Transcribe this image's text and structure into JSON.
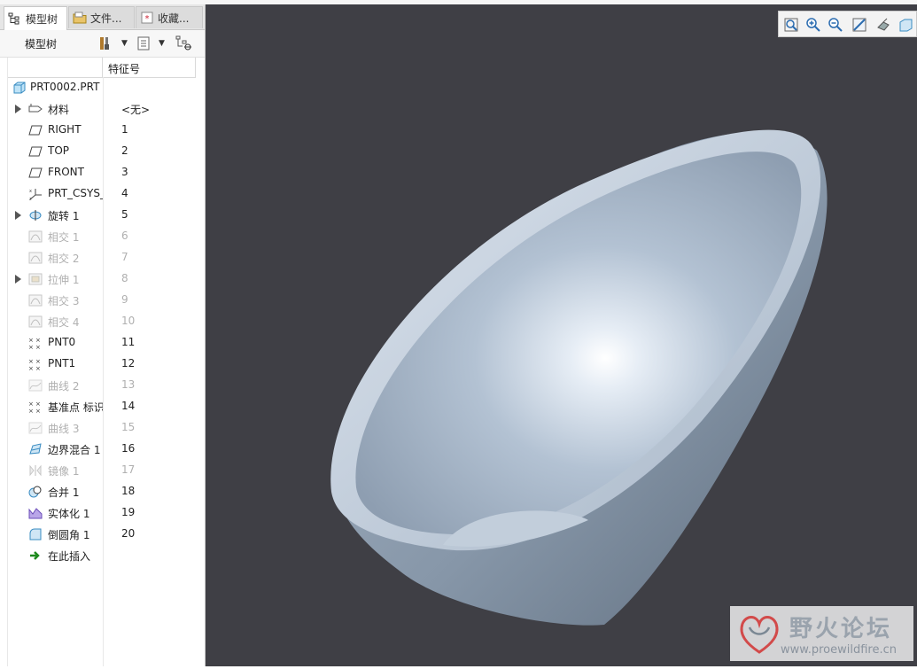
{
  "tabs": [
    {
      "label": "模型树",
      "icon": "model-tree-icon",
      "active": true
    },
    {
      "label": "文件...",
      "icon": "folder-icon"
    },
    {
      "label": "收藏...",
      "icon": "favorites-icon"
    }
  ],
  "toolbar": {
    "title": "模型树",
    "settings_icon": "settings-icon",
    "show_icon": "show-options-icon",
    "filter_icon": "filter-icon"
  },
  "columns": {
    "feature_id": "特征号"
  },
  "root": {
    "name": "PRT0002.PRT",
    "icon": "part-icon"
  },
  "features": [
    {
      "name": "材料",
      "num": "<无>",
      "icon": "material-icon",
      "expandable": true,
      "disabled": false
    },
    {
      "name": "RIGHT",
      "num": "1",
      "icon": "datum-plane-icon",
      "expandable": false,
      "disabled": false
    },
    {
      "name": "TOP",
      "num": "2",
      "icon": "datum-plane-icon",
      "expandable": false,
      "disabled": false
    },
    {
      "name": "FRONT",
      "num": "3",
      "icon": "datum-plane-icon",
      "expandable": false,
      "disabled": false
    },
    {
      "name": "PRT_CSYS_DEF",
      "num": "4",
      "icon": "csys-icon",
      "expandable": false,
      "disabled": false
    },
    {
      "name": "旋转 1",
      "num": "5",
      "icon": "revolve-icon",
      "expandable": true,
      "disabled": false
    },
    {
      "name": "相交 1",
      "num": "6",
      "icon": "intersect-icon",
      "expandable": false,
      "disabled": true
    },
    {
      "name": "相交 2",
      "num": "7",
      "icon": "intersect-icon",
      "expandable": false,
      "disabled": true
    },
    {
      "name": "拉伸 1",
      "num": "8",
      "icon": "extrude-icon",
      "expandable": true,
      "disabled": true
    },
    {
      "name": "相交 3",
      "num": "9",
      "icon": "intersect-icon",
      "expandable": false,
      "disabled": true
    },
    {
      "name": "相交 4",
      "num": "10",
      "icon": "intersect-icon",
      "expandable": false,
      "disabled": true
    },
    {
      "name": "PNT0",
      "num": "11",
      "icon": "datum-point-icon",
      "expandable": false,
      "disabled": false
    },
    {
      "name": "PNT1",
      "num": "12",
      "icon": "datum-point-icon",
      "expandable": false,
      "disabled": false
    },
    {
      "name": "曲线 2",
      "num": "13",
      "icon": "curve-icon",
      "expandable": false,
      "disabled": true
    },
    {
      "name": "基准点 标识",
      "num": "14",
      "icon": "datum-point-icon",
      "expandable": false,
      "disabled": false
    },
    {
      "name": "曲线 3",
      "num": "15",
      "icon": "curve-icon",
      "expandable": false,
      "disabled": true
    },
    {
      "name": "边界混合 1",
      "num": "16",
      "icon": "boundary-blend-icon",
      "expandable": false,
      "disabled": false
    },
    {
      "name": "镜像 1",
      "num": "17",
      "icon": "mirror-icon",
      "expandable": false,
      "disabled": true
    },
    {
      "name": "合并 1",
      "num": "18",
      "icon": "merge-icon",
      "expandable": false,
      "disabled": false
    },
    {
      "name": "实体化 1",
      "num": "19",
      "icon": "solidify-icon",
      "expandable": false,
      "disabled": false
    },
    {
      "name": "倒圆角 1",
      "num": "20",
      "icon": "round-icon",
      "expandable": false,
      "disabled": false
    },
    {
      "name": "在此插入",
      "num": "",
      "icon": "insert-here-icon",
      "expandable": false,
      "disabled": false
    }
  ],
  "view_toolbar": [
    "zoom-fit-icon",
    "zoom-in-icon",
    "zoom-out-icon",
    "repaint-icon",
    "display-style-icon",
    "saved-views-icon"
  ],
  "watermark": {
    "title": "野火论坛",
    "url": "www.proewildfire.cn"
  },
  "colors": {
    "viewport_bg": "#3f3f45",
    "model": "#a9b9cb"
  }
}
